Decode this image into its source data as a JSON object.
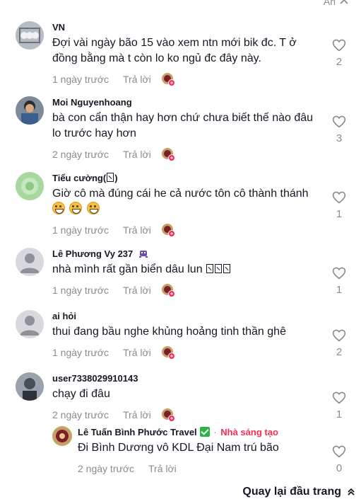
{
  "header": {
    "hide_label": "Ẩn"
  },
  "reply_label": "Trả lời",
  "comments": [
    {
      "username": "VN",
      "text": "Đợi vài ngày bão 15 vào xem ntn mới bik đc. T ở đồng bằng mà t còn lo ko ngủ đc đây này.",
      "time": "1 ngày trước",
      "likes": "2"
    },
    {
      "username": "Moi Nguyenhoang",
      "text": "bà con cẩn thận hay hơn chứ chưa biết thế nào đâu lo trước hay hơn",
      "time": "2 ngày trước",
      "likes": "3"
    },
    {
      "username": "Tiểu cường(",
      "username_suffix": ")",
      "text": "Giờ cô mà đúng cái he cả nước tôn cô thành thánh",
      "time": "1 ngày trước",
      "likes": "1"
    },
    {
      "username": "Lê Phương Vy 237",
      "text": "nhà mình rất gần biển dâu lun",
      "time": "1 ngày trước",
      "likes": "1"
    },
    {
      "username": "ai hỏi",
      "text": "thui đang bầu nghe khủng hoảng tinh thần ghê",
      "time": "1 ngày trước",
      "likes": "2"
    },
    {
      "username": "user7338029910143",
      "text": "chạy đi đâu",
      "time": "2 ngày trước",
      "likes": "1"
    }
  ],
  "reply": {
    "username": "Lê Tuấn Bình Phước Travel",
    "separator": "·",
    "badge": "Nhà sáng tạo",
    "text": "Đi Bình Dương vô KDL Đại Nam trú bão",
    "time": "2 ngày trước",
    "likes": "0"
  },
  "footer": {
    "back_to_top": "Quay lại đầu trang"
  },
  "colors": {
    "creator_badge": "#fe2c55",
    "meta_text": "#8a8b91",
    "text": "#161823"
  }
}
